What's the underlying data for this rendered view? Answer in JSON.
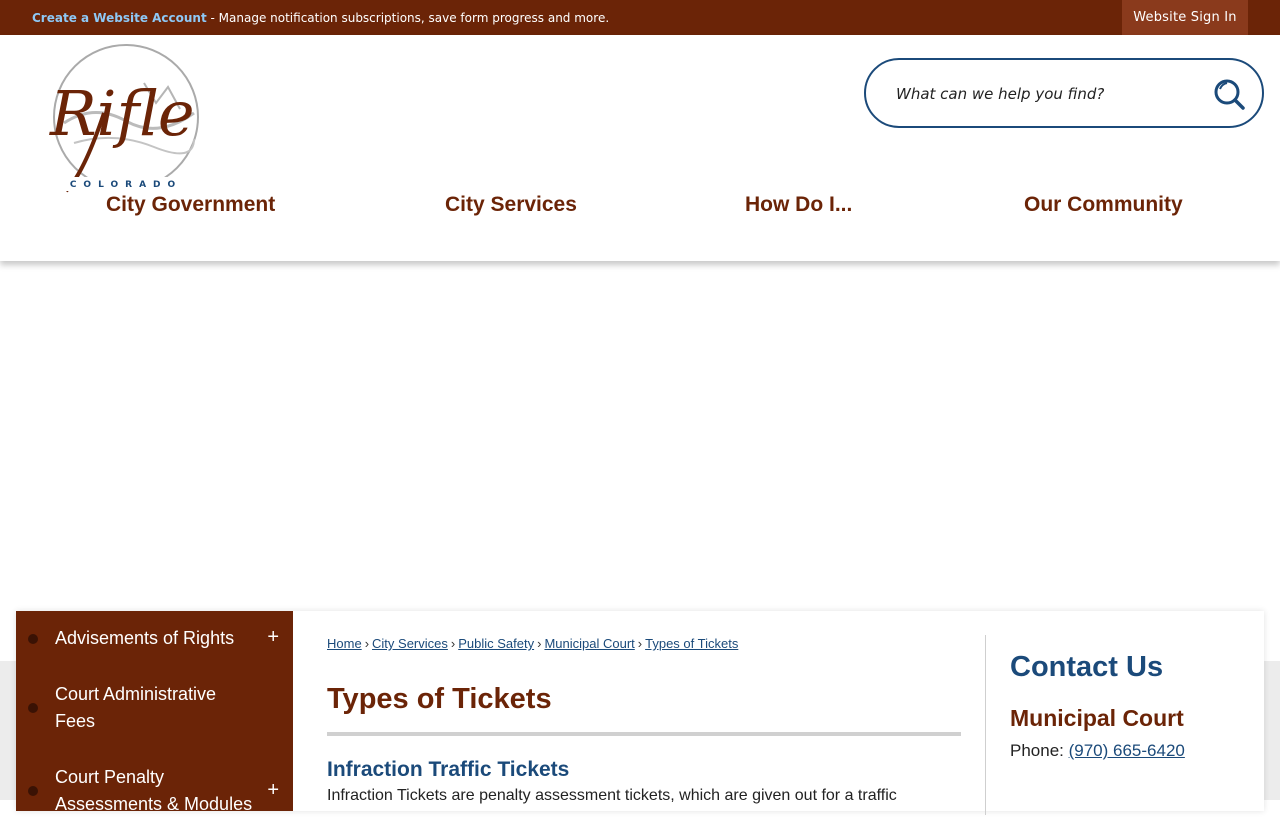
{
  "topbar": {
    "create_account_link": "Create a Website Account",
    "create_account_text": " - Manage notification subscriptions, save form progress and more.",
    "sign_in_label": "Website Sign In"
  },
  "header": {
    "logo": {
      "wordmark": "Rifle",
      "subtext": "COLORADO"
    },
    "search": {
      "placeholder": "What can we help you find?",
      "icon": "search-icon"
    },
    "nav": [
      "City Government",
      "City Services",
      "How Do I...",
      "Our Community"
    ]
  },
  "sidebar": {
    "items": [
      {
        "label": "Advisements of Rights",
        "expandable": true
      },
      {
        "label": "Court Administrative Fees",
        "expandable": false
      },
      {
        "label": "Court Penalty Assessments & Modules",
        "expandable": true
      }
    ]
  },
  "breadcrumb": [
    "Home",
    "City Services",
    "Public Safety",
    "Municipal Court",
    "Types of Tickets"
  ],
  "main": {
    "title": "Types of Tickets",
    "subheading": "Infraction Traffic Tickets",
    "body": "Infraction Tickets are penalty assessment tickets, which are given out for a traffic"
  },
  "contact": {
    "title": "Contact Us",
    "department": "Municipal Court",
    "phone_label": "Phone: ",
    "phone_number": "(970) 665-6420"
  },
  "colors": {
    "brand_brown": "#6b2407",
    "brand_blue": "#1b4a7a",
    "link_light_blue": "#8ec8f5"
  }
}
